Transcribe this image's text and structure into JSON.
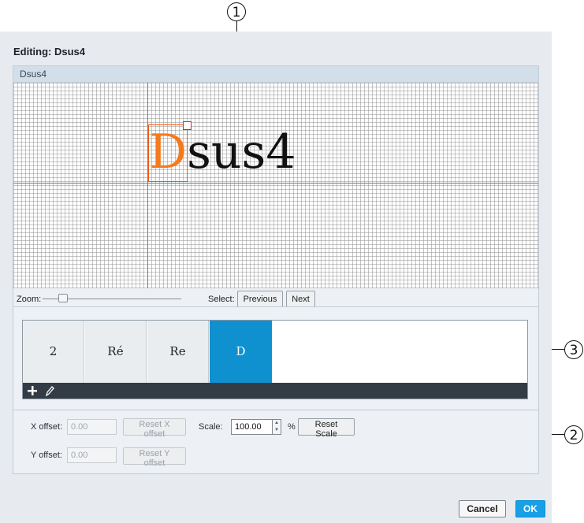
{
  "callouts": [
    "1",
    "2",
    "3"
  ],
  "dialog": {
    "title_label": "Editing:",
    "title_value": "Dsus4"
  },
  "editor": {
    "header": "Dsus4",
    "glyph_selected": "D",
    "glyph_rest": "sus4",
    "zoom_label": "Zoom:",
    "zoom_level": 0.12,
    "select_label": "Select:",
    "previous_label": "Previous",
    "next_label": "Next"
  },
  "chord_list": {
    "items": [
      "2",
      "Ré",
      "Re",
      "D"
    ],
    "selected_index": 3,
    "add_icon": "plus-icon",
    "edit_icon": "pencil-icon"
  },
  "offsets": {
    "x_label": "X offset:",
    "x_value": "0.00",
    "reset_x_label": "Reset X offset",
    "y_label": "Y offset:",
    "y_value": "0.00",
    "reset_y_label": "Reset Y offset",
    "scale_label": "Scale:",
    "scale_value": "100.00",
    "percent": "%",
    "reset_scale_label": "Reset Scale"
  },
  "footer": {
    "cancel_label": "Cancel",
    "ok_label": "OK"
  },
  "colors": {
    "accent": "#0f90cf",
    "glyph_highlight": "#f47a1f",
    "selection_box": "#ee5a12",
    "toolbar": "#333c45"
  }
}
